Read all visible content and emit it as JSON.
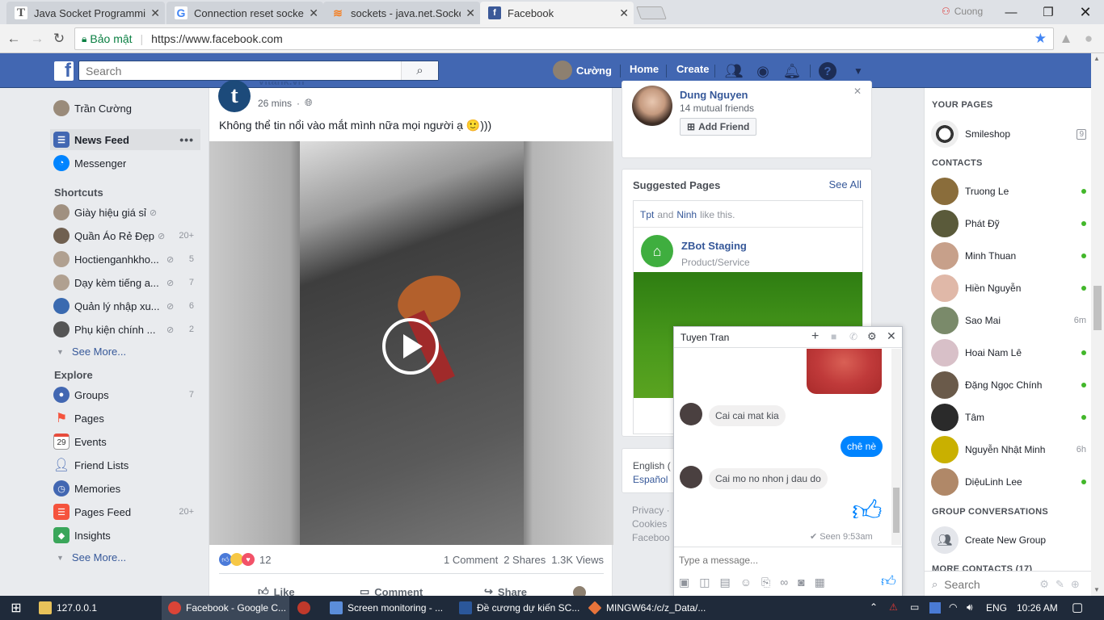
{
  "browser": {
    "tabs": [
      {
        "title": "Java Socket Programming",
        "icon": "text-icon",
        "color": "#555555"
      },
      {
        "title": "Connection reset socket j",
        "icon": "google-icon",
        "color": "#4285f4"
      },
      {
        "title": "sockets - java.net.SocketE",
        "icon": "stackoverflow-icon",
        "color": "#f48024"
      },
      {
        "title": "Facebook",
        "icon": "facebook-icon",
        "color": "#3b5998"
      }
    ],
    "profile_name": "Cuong",
    "secure_label": "Bảo mật",
    "url": "https://www.facebook.com"
  },
  "fb_header": {
    "search_placeholder": "Search",
    "user_name": "Cường",
    "home": "Home",
    "create": "Create"
  },
  "left_nav": {
    "profile_name": "Trần Cường",
    "news_feed": "News Feed",
    "messenger": "Messenger",
    "shortcuts_title": "Shortcuts",
    "shortcuts": [
      {
        "label": "Giày hiệu giá sỉ",
        "count": ""
      },
      {
        "label": "Quần Áo Rẻ Đẹp",
        "count": "20+"
      },
      {
        "label": "Hoctienganhkho...",
        "count": "5"
      },
      {
        "label": "Dạy kèm tiếng a...",
        "count": "7"
      },
      {
        "label": "Quản lý nhập xu...",
        "count": "6"
      },
      {
        "label": "Phụ kiện chính ...",
        "count": "2"
      }
    ],
    "see_more": "See More...",
    "explore_title": "Explore",
    "explore": [
      {
        "label": "Groups",
        "count": "7",
        "color": "#4267b2"
      },
      {
        "label": "Pages",
        "count": "",
        "color": "#f5533d"
      },
      {
        "label": "Events",
        "count": "",
        "color": "#e74c3c",
        "day": "29"
      },
      {
        "label": "Friend Lists",
        "count": "",
        "color": "#4267b2"
      },
      {
        "label": "Memories",
        "count": "",
        "color": "#4267b2"
      },
      {
        "label": "Pages Feed",
        "count": "20+",
        "color": "#f5533d"
      },
      {
        "label": "Insights",
        "count": "",
        "color": "#3aa65a"
      }
    ],
    "see_more_2": "See More..."
  },
  "post": {
    "author": "Vitank.vn",
    "time": "26 mins",
    "text": "Không thể tin nổi vào mắt mình nữa mọi người ạ 🙂)))",
    "reactions_count": "12",
    "comments": "1 Comment",
    "shares": "2 Shares",
    "views": "1.3K Views",
    "like": "Like",
    "comment": "Comment",
    "share": "Share"
  },
  "friend_suggestion": {
    "name": "Dung Nguyen",
    "mutual": "14 mutual friends",
    "add_friend": "Add Friend"
  },
  "suggested_pages": {
    "title": "Suggested Pages",
    "see_all": "See All",
    "liked_by_1": "Tpt",
    "liked_by_and": "and",
    "liked_by_2": "Ninh",
    "liked_by_suffix": "like this.",
    "page_name": "ZBot Staging",
    "page_category": "Product/Service"
  },
  "language": {
    "english": "English (",
    "espanol": "Español"
  },
  "footer": {
    "privacy": "Privacy ·",
    "cookies": "Cookies",
    "facebook": "Faceboo"
  },
  "chat": {
    "name": "Tuyen Tran",
    "messages": [
      {
        "from": "them",
        "text": "Cai cai mat kia"
      },
      {
        "from": "me",
        "text": "chê nè"
      },
      {
        "from": "them",
        "text": "Cai mo no nhon j dau do"
      }
    ],
    "seen": "Seen 9:53am",
    "input_placeholder": "Type a message..."
  },
  "sidebar": {
    "your_pages_title": "YOUR PAGES",
    "your_pages": [
      {
        "name": "Smileshop",
        "badge": "9"
      }
    ],
    "contacts_title": "CONTACTS",
    "contacts": [
      {
        "name": "Truong Le",
        "status": "online",
        "color": "#8a6d3b"
      },
      {
        "name": "Phát Đỹ",
        "status": "online",
        "color": "#5a5a3a"
      },
      {
        "name": "Minh Thuan",
        "status": "online",
        "color": "#c7a08a"
      },
      {
        "name": "Hiền Nguyễn",
        "status": "online",
        "color": "#e0b8a8"
      },
      {
        "name": "Sao Mai",
        "status": "6m",
        "color": "#7a8a6a"
      },
      {
        "name": "Hoai Nam Lê",
        "status": "online",
        "color": "#d8c0c8"
      },
      {
        "name": "Đặng Ngọc Chính",
        "status": "online",
        "color": "#6a5a4a"
      },
      {
        "name": "Tâm",
        "status": "online",
        "color": "#2a2a2a"
      },
      {
        "name": "Nguyễn Nhật Minh",
        "status": "6h",
        "color": "#c9b000"
      },
      {
        "name": "DiệuLinh Lee",
        "status": "online",
        "color": "#b08868"
      }
    ],
    "group_title": "GROUP CONVERSATIONS",
    "create_group": "Create New Group",
    "more_contacts": "MORE CONTACTS (17)",
    "search_placeholder": "Search"
  },
  "taskbar": {
    "items": [
      {
        "label": "127.0.0.1",
        "color": "#e8c25a"
      },
      {
        "label": "Facebook - Google C...",
        "color": "#db4437"
      },
      {
        "label": "",
        "color": "#c0392b"
      },
      {
        "label": "Screen monitoring - ...",
        "color": "#5b8dd9"
      },
      {
        "label": "Đề cương dự kiến SC...",
        "color": "#2b579a"
      },
      {
        "label": "MINGW64:/c/z_Data/...",
        "color": "#e8743b"
      }
    ],
    "lang": "ENG",
    "time": "10:26 AM"
  }
}
